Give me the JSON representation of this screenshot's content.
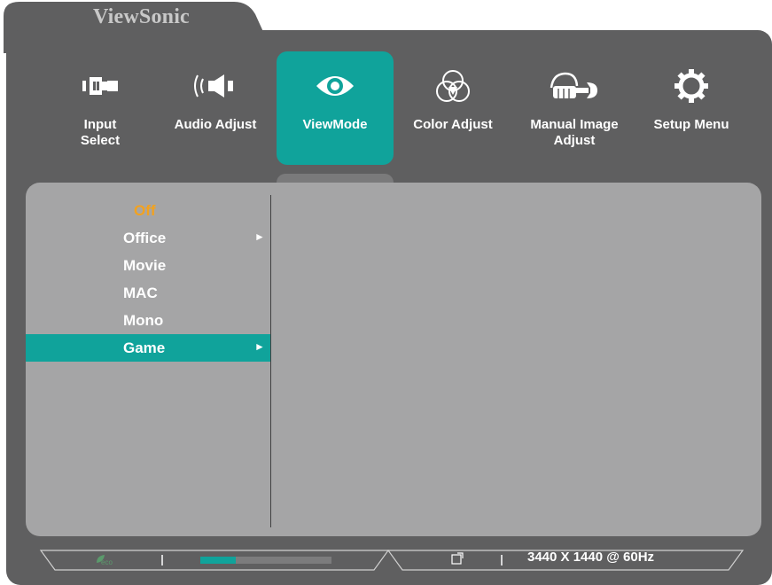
{
  "brand": "ViewSonic",
  "nav": {
    "items": [
      {
        "label": "Input\nSelect",
        "icon": "input-select-icon"
      },
      {
        "label": "Audio Adjust",
        "icon": "speaker-icon"
      },
      {
        "label": "ViewMode",
        "icon": "eye-icon",
        "active": true
      },
      {
        "label": "Color Adjust",
        "icon": "color-circles-icon"
      },
      {
        "label": "Manual Image\nAdjust",
        "icon": "hand-wrench-icon"
      },
      {
        "label": "Setup Menu",
        "icon": "gear-icon"
      }
    ]
  },
  "menu": {
    "items": [
      {
        "label": "Off",
        "current": true,
        "submenu": false
      },
      {
        "label": "Office",
        "submenu": true
      },
      {
        "label": "Movie",
        "submenu": false
      },
      {
        "label": "MAC",
        "submenu": false
      },
      {
        "label": "Mono",
        "submenu": false
      },
      {
        "label": "Game",
        "submenu": true,
        "selected": true
      }
    ],
    "submenu_arrow": "►"
  },
  "status": {
    "eco_label": "eco",
    "resolution": "3440 X 1440 @ 60Hz",
    "icons": [
      "eco-leaf-icon",
      "brightness-meter-icon",
      "external-link-icon"
    ]
  },
  "colors": {
    "accent": "#10a39b",
    "current_value": "#f3a21e",
    "frame": "#5f5f60",
    "panel": "#a5a5a6"
  }
}
